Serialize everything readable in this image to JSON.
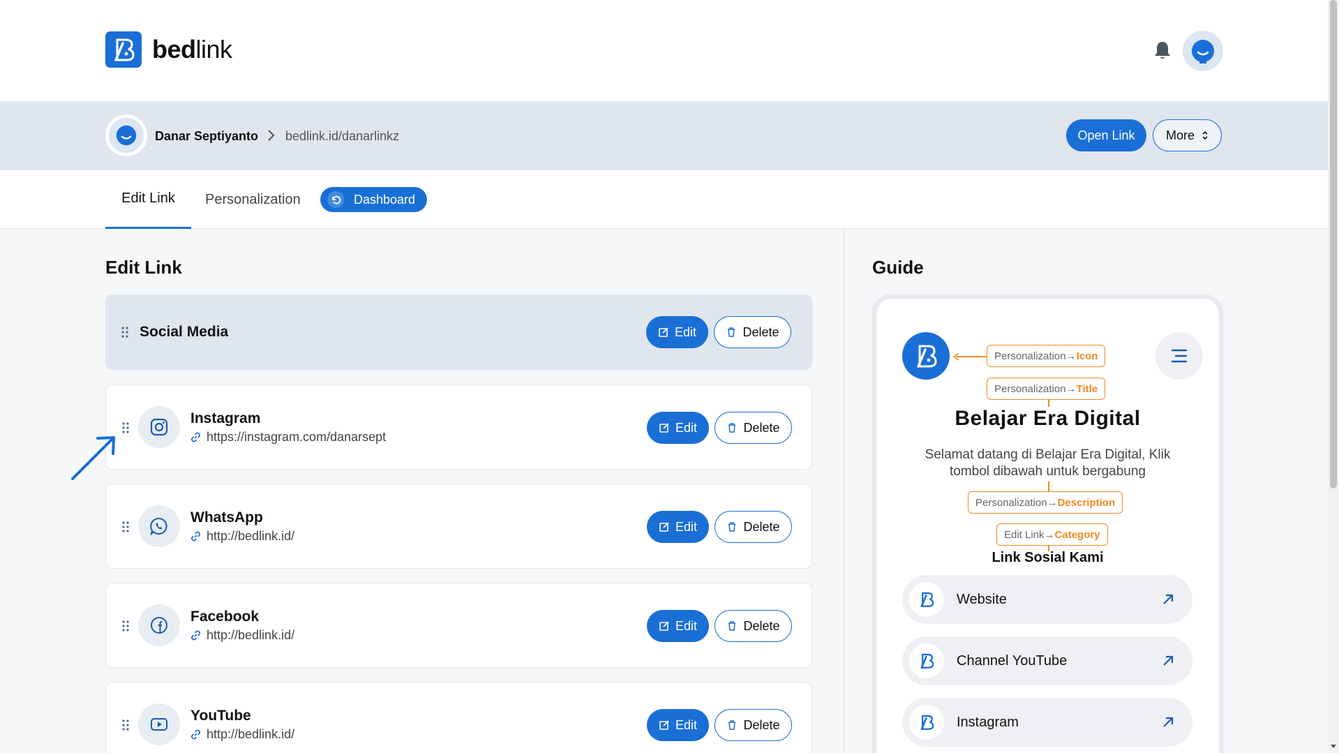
{
  "brand": {
    "name_bold": "bed",
    "name_light": "link"
  },
  "profile": {
    "name": "Danar Septiyanto",
    "url": "bedlink.id/danarlinkz",
    "open_link_label": "Open Link",
    "more_label": "More"
  },
  "tabs": {
    "edit_link": "Edit Link",
    "personalization": "Personalization",
    "dashboard": "Dashboard"
  },
  "edit_section": {
    "title": "Edit Link",
    "category": {
      "title": "Social Media",
      "edit_label": "Edit",
      "delete_label": "Delete"
    },
    "links": [
      {
        "title": "Instagram",
        "url": "https://instagram.com/danarsept",
        "icon": "instagram-icon",
        "edit_label": "Edit",
        "delete_label": "Delete"
      },
      {
        "title": "WhatsApp",
        "url": "http://bedlink.id/",
        "icon": "whatsapp-icon",
        "edit_label": "Edit",
        "delete_label": "Delete"
      },
      {
        "title": "Facebook",
        "url": "http://bedlink.id/",
        "icon": "facebook-icon",
        "edit_label": "Edit",
        "delete_label": "Delete"
      },
      {
        "title": "YouTube",
        "url": "http://bedlink.id/",
        "icon": "youtube-icon",
        "edit_label": "Edit",
        "delete_label": "Delete"
      }
    ]
  },
  "guide": {
    "title": "Guide",
    "tags": {
      "icon_prefix": "Personalization→",
      "icon_key": "Icon",
      "title_prefix": "Personalization→",
      "title_key": "Title",
      "desc_prefix": "Personalization→",
      "desc_key": "Description",
      "cat_prefix": "Edit Link→",
      "cat_key": "Category"
    },
    "preview_title": "Belajar Era Digital",
    "preview_description": "Selamat datang di Belajar Era Digital, Klik tombol dibawah untuk bergabung",
    "preview_category": "Link Sosial Kami",
    "preview_links": [
      "Website",
      "Channel YouTube",
      "Instagram"
    ]
  },
  "colors": {
    "primary": "#1a6fd6",
    "accent": "#f08a24",
    "profile_bg": "#dfe6ee",
    "main_bg": "#f5f7f9"
  }
}
